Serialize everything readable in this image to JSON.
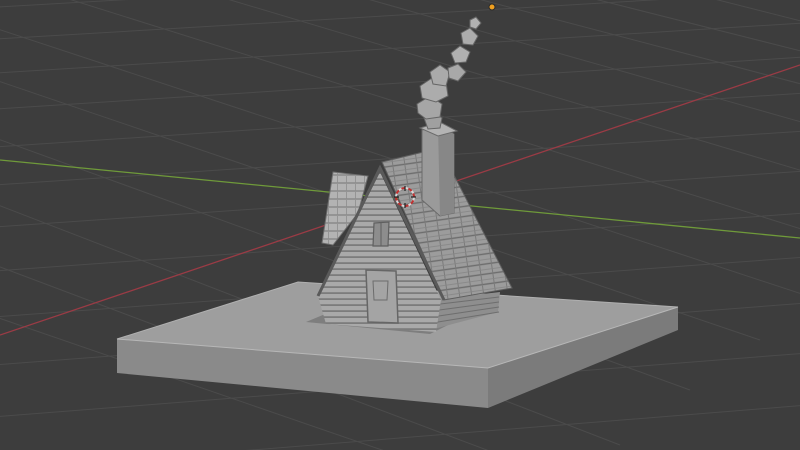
{
  "viewport": {
    "mode": "solid-shading",
    "background_color": "#3d3d3d",
    "grid_color": "#4a4a4a",
    "x_axis_color": "#9a3b45",
    "y_axis_color": "#6f9a3a",
    "origin_marker_color": "#f0a020"
  },
  "scene": {
    "objects": [
      "ground-slab",
      "house-body",
      "roof",
      "chimney",
      "smoke",
      "door",
      "window",
      "cursor-3d"
    ]
  }
}
